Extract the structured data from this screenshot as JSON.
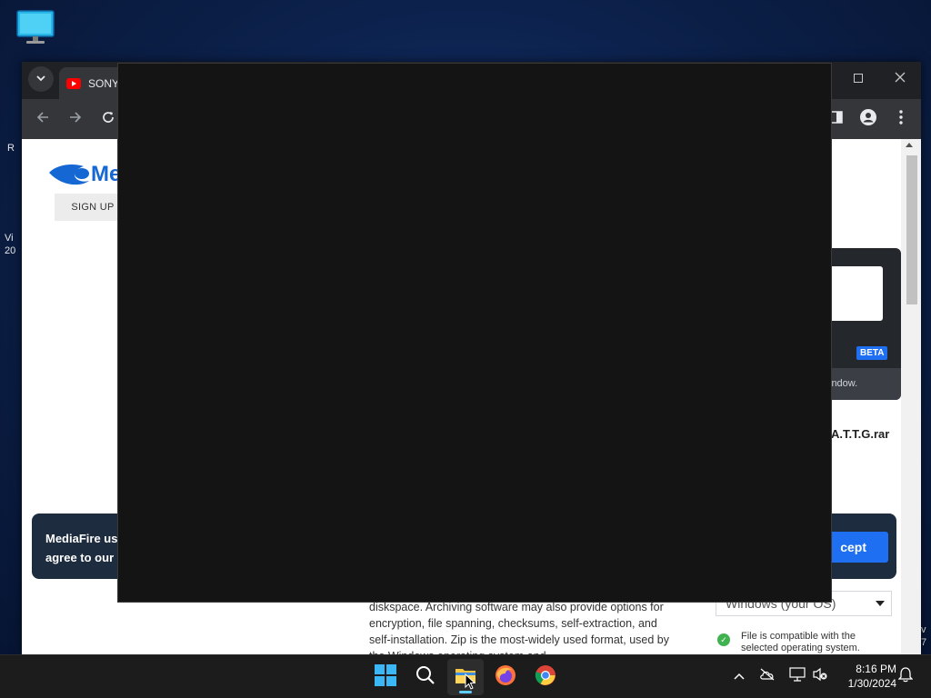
{
  "desktop": {
    "side_texts": [
      "R",
      "Vi",
      "20",
      "v",
      "7"
    ]
  },
  "browser": {
    "tab": {
      "title": "SONY"
    },
    "toolbar": {},
    "page": {
      "logo_text": "Me",
      "signup_label": "SIGN UP",
      "cookie": {
        "line1": "MediaFire use",
        "line2": "agree to our P",
        "accept_label": "cept"
      },
      "archive_description": "diskspace. Archiving software may also provide options for encryption, file spanning, checksums, self-extraction, and self-installation. Zip is the most-widely used format, used by the Windows operating system and...",
      "right_panel": {
        "beta_label": "BETA",
        "window_text": "indow.",
        "filename": "A.T.T.G.rar",
        "os_select_value": "Windows (your OS)",
        "compat_text": "File is compatible with the selected operating system."
      }
    }
  },
  "taskbar": {
    "time": "8:16 PM",
    "date": "1/30/2024"
  },
  "colors": {
    "accent_blue": "#1e6ff2",
    "cookie_bg": "#1d2c3f",
    "taskbar_bg": "#1c1c1c",
    "compat_green": "#3fb34f"
  }
}
